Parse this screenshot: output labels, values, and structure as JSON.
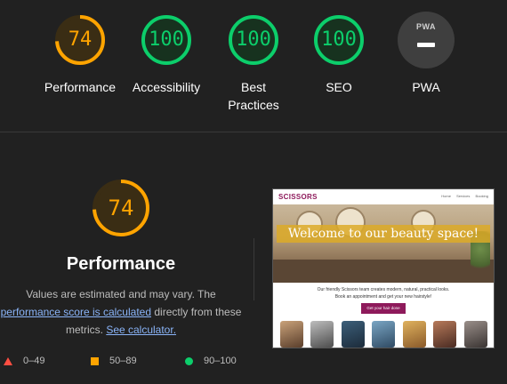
{
  "scores": [
    {
      "label": "Performance",
      "value": "74",
      "fraction": 0.74,
      "color": "#ffa400",
      "fill": "#3a2d14"
    },
    {
      "label": "Accessibility",
      "value": "100",
      "fraction": 1.0,
      "color": "#0cce6b",
      "fill": "#17321f"
    },
    {
      "label": "Best Practices",
      "value": "100",
      "fraction": 1.0,
      "color": "#0cce6b",
      "fill": "#17321f"
    },
    {
      "label": "SEO",
      "value": "100",
      "fraction": 1.0,
      "color": "#0cce6b",
      "fill": "#17321f"
    }
  ],
  "pwa": {
    "label": "PWA",
    "badge_text": "PWA"
  },
  "performance": {
    "score": "74",
    "fraction": 0.74,
    "title": "Performance",
    "desc_start": "Values are estimated and may vary. The",
    "link_calc": "performance score is calculated",
    "desc_mid": "directly from these metrics.",
    "link_see": "See calculator."
  },
  "legend": [
    {
      "shape": "triangle",
      "range": "0–49",
      "color": "#ff4e42"
    },
    {
      "shape": "square",
      "range": "50–89",
      "color": "#ffa400"
    },
    {
      "shape": "circle",
      "range": "90–100",
      "color": "#0cce6b"
    }
  ],
  "screenshot": {
    "logo": "SCISSORS",
    "nav": [
      "Home",
      "Services",
      "Booking"
    ],
    "banner": "Welcome to our beauty space!",
    "copy_line1": "Our friendly Scissors team creates modern, natural, practical looks.",
    "copy_line2": "Book an appointment and get your new hairstyle!",
    "cta": "Get your hair done"
  },
  "colors": {
    "background": "#212121",
    "pass": "#0cce6b",
    "average": "#ffa400",
    "fail": "#ff4e42",
    "link": "#8ab4f8"
  }
}
